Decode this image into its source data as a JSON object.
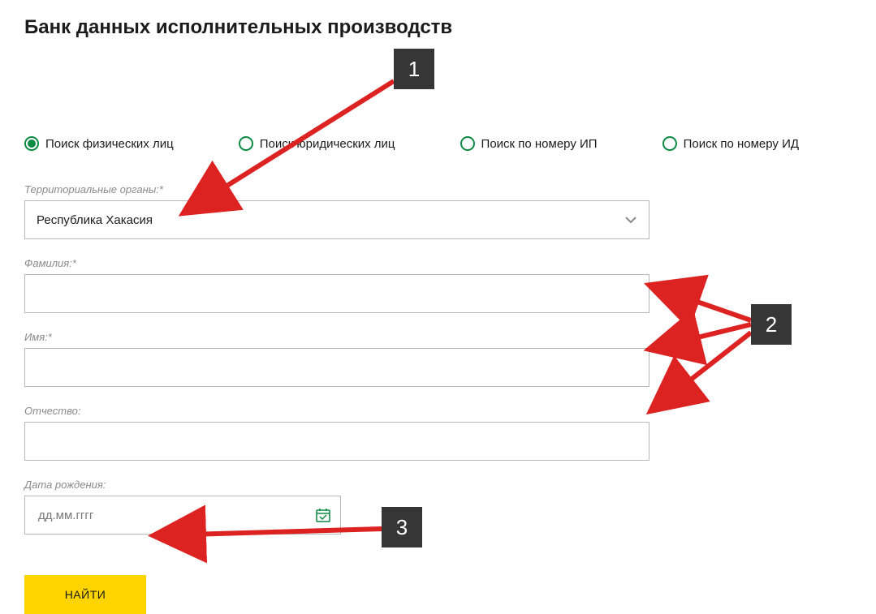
{
  "title": "Банк данных исполнительных производств",
  "radios": {
    "phys": "Поиск физических лиц",
    "legal": "Поиск юридических лиц",
    "ip": "Поиск по номеру ИП",
    "id": "Поиск по номеру ИД"
  },
  "labels": {
    "territory": "Территориальные органы:*",
    "surname": "Фамилия:*",
    "name": "Имя:*",
    "patronym": "Отчество:",
    "birthdate": "Дата рождения:"
  },
  "values": {
    "territory": "Республика Хакасия",
    "surname": "",
    "name": "",
    "patronym": ""
  },
  "placeholders": {
    "birthdate": "дд.мм.гггг"
  },
  "buttons": {
    "search": "НАЙТИ"
  },
  "annotations": {
    "n1": "1",
    "n2": "2",
    "n3": "3"
  }
}
